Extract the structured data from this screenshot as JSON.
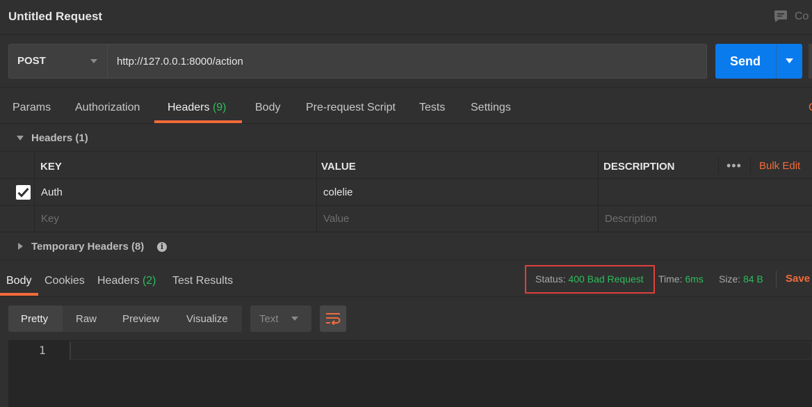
{
  "request": {
    "title": "Untitled Request",
    "comments_label": "Co"
  },
  "url_bar": {
    "method": "POST",
    "url": "http://127.0.0.1:8000/action",
    "send_label": "Send"
  },
  "request_tabs": [
    {
      "label": "Params"
    },
    {
      "label": "Authorization"
    },
    {
      "label": "Headers",
      "count": "(9)"
    },
    {
      "label": "Body"
    },
    {
      "label": "Pre-request Script"
    },
    {
      "label": "Tests"
    },
    {
      "label": "Settings"
    }
  ],
  "request_tabs_right": "C",
  "headers_section": {
    "label": "Headers",
    "count": "(1)",
    "columns": {
      "key": "KEY",
      "value": "VALUE",
      "description": "DESCRIPTION"
    },
    "bulk_edit": "Bulk Edit",
    "more": "•••",
    "rows": [
      {
        "key": "Auth",
        "value": "colelie",
        "description": "",
        "enabled": true
      }
    ],
    "placeholders": {
      "key": "Key",
      "value": "Value",
      "description": "Description"
    }
  },
  "temp_headers": {
    "label": "Temporary Headers",
    "count": "(8)",
    "info": "i"
  },
  "response": {
    "tabs": [
      {
        "label": "Body"
      },
      {
        "label": "Cookies"
      },
      {
        "label": "Headers",
        "count": "(2)"
      },
      {
        "label": "Test Results"
      }
    ],
    "status_label": "Status:",
    "status_value": "400 Bad Request",
    "time_label": "Time:",
    "time_value": "6ms",
    "size_label": "Size:",
    "size_value": "84 B",
    "save_label": "Save"
  },
  "body_toolbar": {
    "formats": [
      "Pretty",
      "Raw",
      "Preview",
      "Visualize"
    ],
    "active_format": "Pretty",
    "language": "Text"
  },
  "editor": {
    "line_numbers": [
      "1"
    ]
  },
  "colors": {
    "accent": "#f26b3a",
    "send": "#097bed",
    "success": "#2dbd5c",
    "status_box": "#e0403a"
  },
  "icons": [
    "comment-icon",
    "caret-down-icon",
    "check-icon",
    "triangle-down-icon",
    "triangle-right-icon",
    "info-icon",
    "wrap-lines-icon"
  ]
}
